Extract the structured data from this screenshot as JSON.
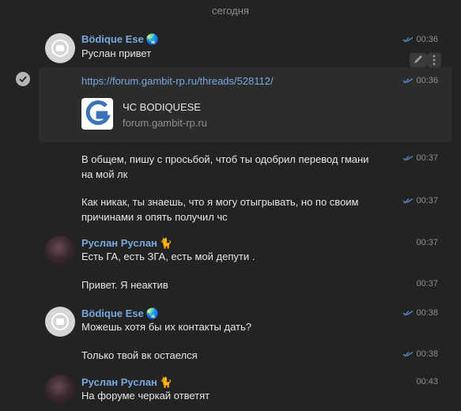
{
  "date_separator": "сегодня",
  "messages": [
    {
      "author": "Bödique Ese",
      "badge": "🌏",
      "text": "Руслан привет",
      "time": "00:36",
      "read": true
    },
    {
      "link": "https://forum.gambit-rp.ru/threads/528112/",
      "preview_title": "ЧС BODIQUESE",
      "preview_domain": "forum.gambit-rp.ru",
      "time": "00:36",
      "read": true
    },
    {
      "text": "В общем, пишу с просьбой, чтоб ты одобрил перевод гмани на мой лк",
      "time": "00:37",
      "read": true
    },
    {
      "text": "Как никак, ты знаешь, что я могу отыгрывать, но по своим причинами я опять получил чс",
      "time": "00:37",
      "read": true
    },
    {
      "author": "Руслан Руслан",
      "badge": "🐈",
      "text": "Есть ГА, есть ЗГА, есть мой депути .",
      "time": "00:37"
    },
    {
      "text": "Привет. Я неактив",
      "time": "00:37"
    },
    {
      "author": "Bödique Ese",
      "badge": "🌏",
      "text": "Можешь хотя бы их контакты дать?",
      "time": "00:38",
      "read": true
    },
    {
      "text": "Только твой вк остаелся",
      "time": "00:38",
      "read": true
    },
    {
      "author": "Руслан Руслан",
      "badge": "🐈",
      "text": "На форуме черкай ответят",
      "time": "00:43"
    }
  ],
  "icons": {
    "read_ticks": "double-check-icon",
    "select_mark": "check-circle-icon",
    "edit": "pencil-icon",
    "more": "more-icon"
  },
  "colors": {
    "background": "#232323",
    "author_name": "#7aa8e0",
    "text": "#e6e6e6",
    "muted": "#8f8f8f",
    "read_ticks": "#5e8fd0"
  }
}
